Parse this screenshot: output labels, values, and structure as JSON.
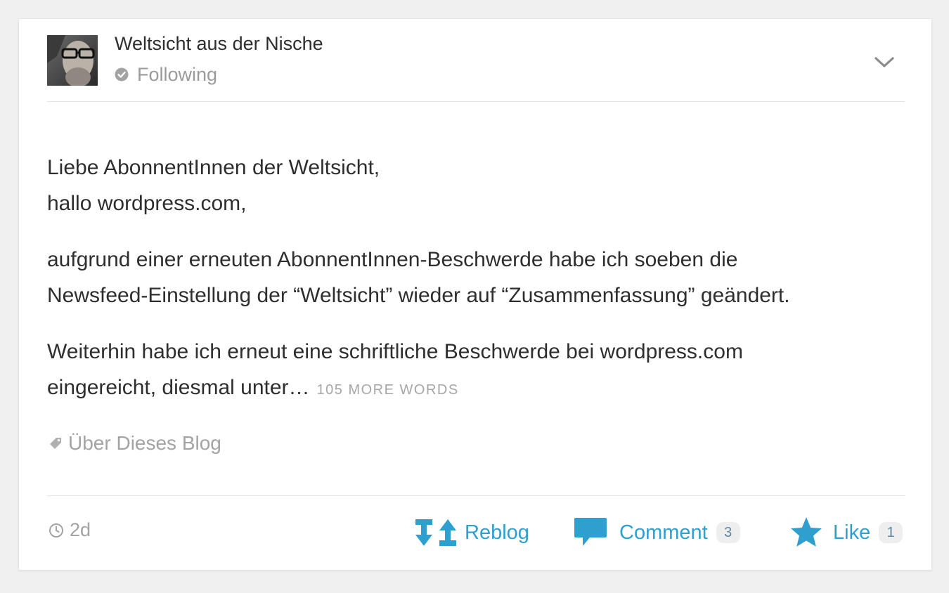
{
  "post": {
    "blog_name": "Weltsicht aus der Nische",
    "follow_status": "Following",
    "paragraphs": [
      {
        "lines": [
          "Liebe AbonnentInnen der Weltsicht,",
          "hallo wordpress.com,"
        ]
      },
      {
        "lines": [
          "aufgrund einer erneuten AbonnentInnen-Beschwerde habe ich soeben die",
          "Newsfeed-Einstellung der “Weltsicht” wieder auf “Zusammenfassung” geändert."
        ]
      },
      {
        "lines": [
          "Weiterhin habe ich erneut eine schriftliche Beschwerde bei wordpress.com",
          "eingereicht, diesmal unter…"
        ],
        "more_words": "105 MORE WORDS"
      }
    ],
    "tag": "Über Dieses Blog",
    "age": "2d"
  },
  "actions": {
    "reblog": {
      "label": "Reblog",
      "icon": "reblog-icon"
    },
    "comment": {
      "label": "Comment",
      "count": "3",
      "icon": "comment-bubble-icon"
    },
    "like": {
      "label": "Like",
      "count": "1",
      "icon": "star-icon"
    }
  },
  "colors": {
    "accent": "#2e9fcf",
    "muted_text": "#a3a3a3",
    "body_text": "#2e2e2e",
    "divider": "#e4e4e4",
    "page_background": "#f0f0f0"
  }
}
